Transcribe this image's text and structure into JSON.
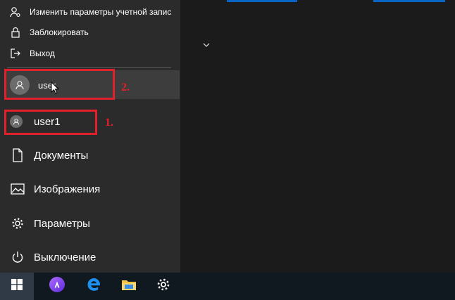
{
  "start_menu": {
    "account_menu": {
      "change_account_settings": "Изменить параметры учетной запис",
      "lock": "Заблокировать",
      "sign_out": "Выход",
      "other_account": "user"
    },
    "current_user": "user1",
    "items": [
      {
        "label": "Документы",
        "icon": "document-icon"
      },
      {
        "label": "Изображения",
        "icon": "pictures-icon"
      },
      {
        "label": "Параметры",
        "icon": "gear-icon"
      },
      {
        "label": "Выключение",
        "icon": "power-icon"
      }
    ]
  },
  "annotations": {
    "step1": "1.",
    "step2": "2."
  },
  "taskbar": {
    "buttons": [
      "windows-start-icon",
      "alice-icon",
      "edge-icon",
      "file-explorer-icon",
      "settings-icon"
    ]
  },
  "colors": {
    "menu_bg": "#2b2b2b",
    "hover_bg": "#3d3d3d",
    "annotation_red": "#e0202a",
    "tile_accent": "#0a66c2",
    "taskbar_bg": "#101820"
  }
}
